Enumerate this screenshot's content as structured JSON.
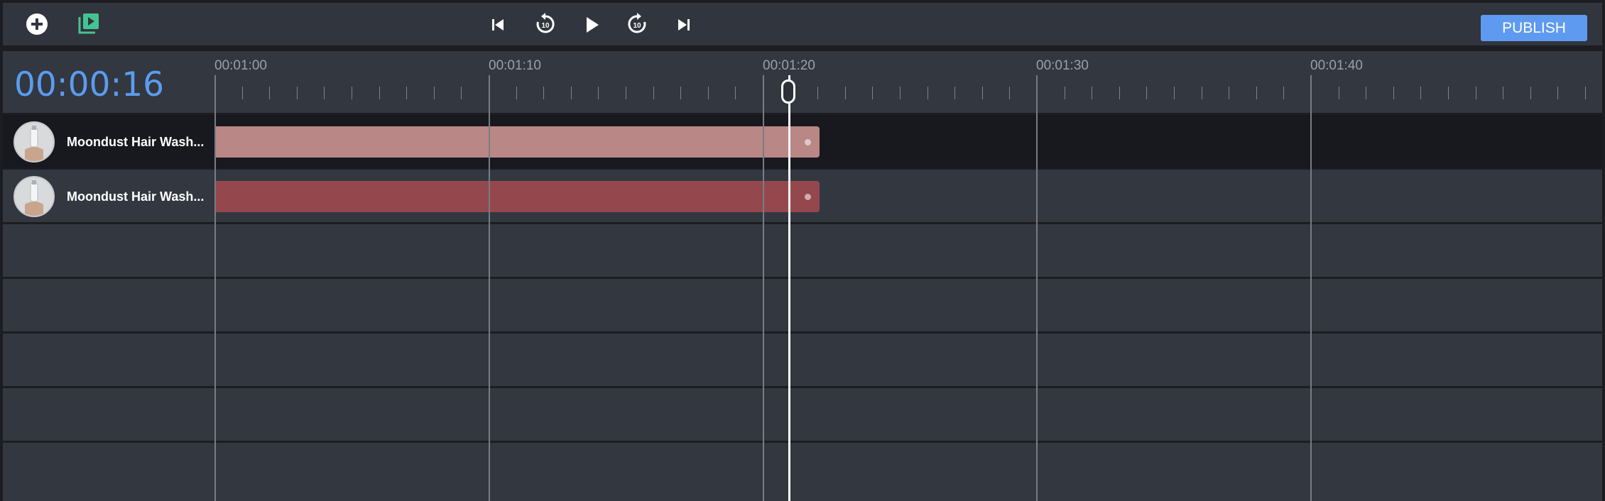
{
  "toolbar": {
    "icons": [
      "add-circle-icon",
      "video-library-icon",
      "skip-to-start-icon",
      "rewind-10-icon",
      "play-icon",
      "forward-10-icon",
      "skip-to-end-icon"
    ],
    "rewind_label": "10",
    "forward_label": "10",
    "publish_label": "PUBLISH"
  },
  "timeline": {
    "current_time": "00:00:16",
    "markers": [
      "00:01:00",
      "00:01:10",
      "00:01:20",
      "00:01:30",
      "00:01:40"
    ],
    "tracks": [
      {
        "label": "Moondust Hair Wash...",
        "selected": true,
        "clip_color": "#b98785"
      },
      {
        "label": "Moondust Hair Wash...",
        "selected": false,
        "clip_color": "#94484d"
      }
    ],
    "empty_rows": 5
  },
  "colors": {
    "accent": "#5e9bf0",
    "timecode": "#5b9cf0",
    "background": "#33373f",
    "add_icon": "#ffffff",
    "library_icon": "#46c393"
  }
}
